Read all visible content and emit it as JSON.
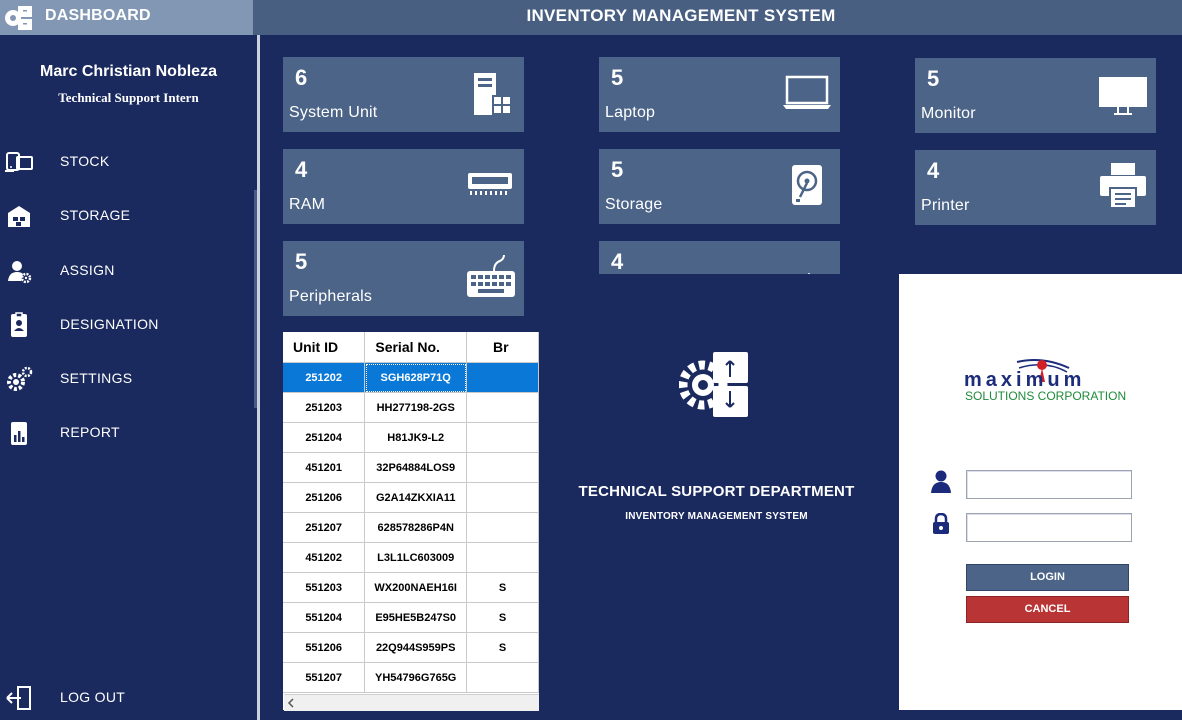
{
  "header": {
    "dashboard_label": "DASHBOARD",
    "app_title": "INVENTORY MANAGEMENT SYSTEM"
  },
  "user": {
    "name": "Marc Christian Nobleza",
    "role": "Technical Support Intern"
  },
  "nav": [
    {
      "label": "STOCK",
      "icon": "devices-icon"
    },
    {
      "label": "STORAGE",
      "icon": "warehouse-icon"
    },
    {
      "label": "ASSIGN",
      "icon": "user-gear-icon"
    },
    {
      "label": "DESIGNATION",
      "icon": "id-badge-icon"
    },
    {
      "label": "SETTINGS",
      "icon": "gear-icon"
    },
    {
      "label": "REPORT",
      "icon": "report-icon"
    }
  ],
  "logout_label": "LOG OUT",
  "cards": [
    {
      "count": "6",
      "label": "System Unit",
      "icon": "system-unit-icon"
    },
    {
      "count": "5",
      "label": "Laptop",
      "icon": "laptop-icon"
    },
    {
      "count": "5",
      "label": "Monitor",
      "icon": "monitor-icon"
    },
    {
      "count": "4",
      "label": "RAM",
      "icon": "ram-icon"
    },
    {
      "count": "5",
      "label": "Storage",
      "icon": "hard-drive-icon"
    },
    {
      "count": "4",
      "label": "Printer",
      "icon": "printer-icon"
    },
    {
      "count": "5",
      "label": "Peripherals",
      "icon": "keyboard-icon"
    },
    {
      "count": "4",
      "label": "",
      "icon": ""
    }
  ],
  "table": {
    "columns": [
      "Unit ID",
      "Serial No.",
      "Br"
    ],
    "rows": [
      [
        "251202",
        "SGH628P71Q",
        ""
      ],
      [
        "251203",
        "HH277198-2GS",
        ""
      ],
      [
        "251204",
        "H81JK9-L2",
        ""
      ],
      [
        "451201",
        "32P64884LOS9",
        ""
      ],
      [
        "251206",
        "G2A14ZKXIA11",
        ""
      ],
      [
        "251207",
        "628578286P4N",
        ""
      ],
      [
        "451202",
        "L3L1LC603009",
        ""
      ],
      [
        "551203",
        "WX200NAEH16I",
        "S"
      ],
      [
        "551204",
        "E95HE5B247S0",
        "S"
      ],
      [
        "551206",
        "22Q944S959PS",
        "S"
      ],
      [
        "551207",
        "YH54796G765G",
        ""
      ]
    ],
    "selected_row": 0
  },
  "login": {
    "department": "TECHNICAL SUPPORT DEPARTMENT",
    "subtitle": "INVENTORY MANAGEMENT SYSTEM",
    "logo_word": "maximum",
    "logo_sub": "SOLUTIONS CORPORATION",
    "username_value": "",
    "password_value": "",
    "login_label": "LOGIN",
    "cancel_label": "CANCEL"
  },
  "colors": {
    "navy": "#1b2a5e",
    "card": "#4c6487",
    "header": "#485f82",
    "selected": "#0a78d7",
    "cancel": "#b93434"
  }
}
